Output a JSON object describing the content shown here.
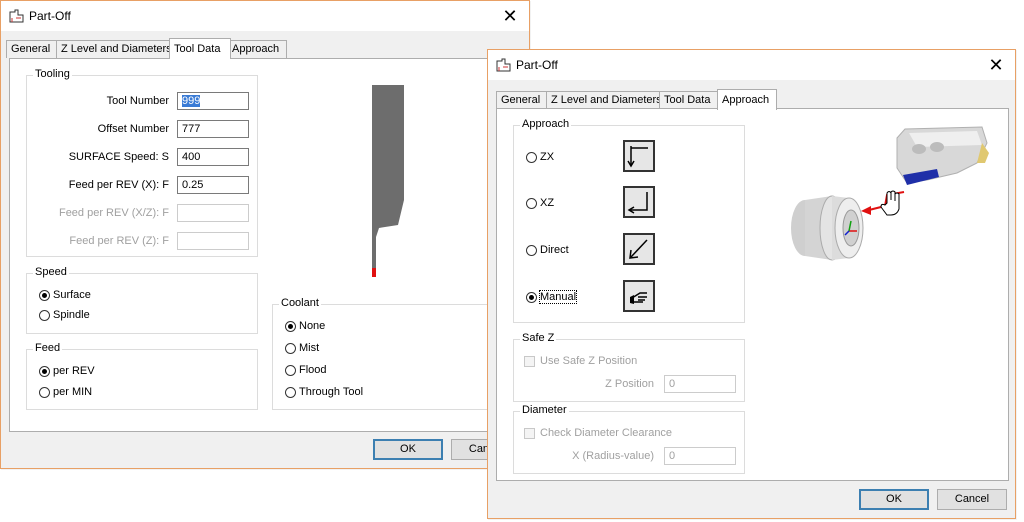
{
  "back_window": {
    "title": "Part-Off",
    "tabs": [
      "General",
      "Z Level and Diameters",
      "Tool Data",
      "Approach"
    ],
    "active_tab": "Tool Data",
    "tooling": {
      "title": "Tooling",
      "tool_number_label": "Tool Number",
      "tool_number_value": "999",
      "offset_number_label": "Offset Number",
      "offset_number_value": "777",
      "surface_speed_label": "SURFACE Speed: S",
      "surface_speed_value": "400",
      "feed_rev_x_label": "Feed per REV (X): F",
      "feed_rev_x_value": "0.25",
      "feed_rev_xz_label": "Feed per REV (X/Z): F",
      "feed_rev_xz_value": "",
      "feed_rev_z_label": "Feed per REV (Z): F",
      "feed_rev_z_value": ""
    },
    "speed": {
      "title": "Speed",
      "options": [
        "Surface",
        "Spindle"
      ],
      "selected": "Surface"
    },
    "feed": {
      "title": "Feed",
      "options": [
        "per REV",
        "per MIN"
      ],
      "selected": "per REV"
    },
    "coolant": {
      "title": "Coolant",
      "options": [
        "None",
        "Mist",
        "Flood",
        "Through Tool"
      ],
      "selected": "None"
    },
    "ok_label": "OK",
    "cancel_label": "Cancel"
  },
  "front_window": {
    "title": "Part-Off",
    "tabs": [
      "General",
      "Z Level and Diameters",
      "Tool Data",
      "Approach"
    ],
    "active_tab": "Approach",
    "approach": {
      "title": "Approach",
      "options": [
        {
          "label": "ZX",
          "icon": "approach-zx-icon"
        },
        {
          "label": "XZ",
          "icon": "approach-xz-icon"
        },
        {
          "label": "Direct",
          "icon": "approach-direct-icon"
        },
        {
          "label": "Manual",
          "icon": "approach-manual-hand-icon"
        }
      ],
      "selected": "Manual"
    },
    "safe_z": {
      "title": "Safe Z",
      "checkbox_label": "Use Safe Z Position",
      "position_label": "Z Position",
      "position_value": "0"
    },
    "diameter": {
      "title": "Diameter",
      "checkbox_label": "Check Diameter Clearance",
      "x_label": "X (Radius-value)",
      "x_value": "0"
    },
    "ok_label": "OK",
    "cancel_label": "Cancel"
  }
}
